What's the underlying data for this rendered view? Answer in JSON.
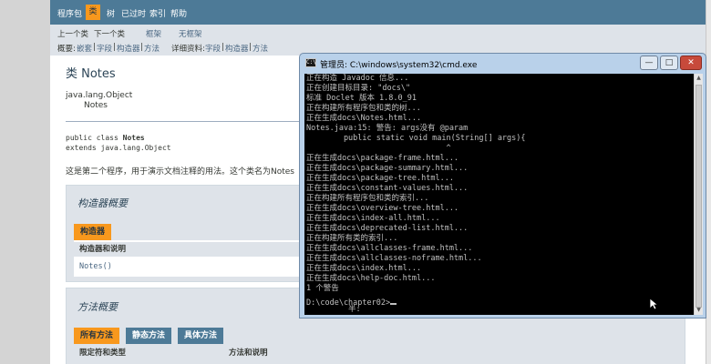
{
  "topnav": {
    "items": [
      "程序包",
      "类",
      "树",
      "已过时",
      "索引",
      "帮助"
    ],
    "active": "类"
  },
  "subnav": {
    "prev_class": "上一个类",
    "next_class": "下一个类",
    "frames": "框架",
    "no_frames": "无框架",
    "summary_label": "概要:",
    "summary_nested": "嵌套",
    "summary_field": "字段",
    "summary_constr": "构造器",
    "summary_method": "方法",
    "detail_label": "详细资料:",
    "detail_field": "字段",
    "detail_constr": "构造器",
    "detail_method": "方法",
    "sep": "|"
  },
  "class_page": {
    "title": "类 Notes",
    "inherit_parent": "java.lang.Object",
    "inherit_child": "Notes",
    "sig_prefix": "public class ",
    "sig_name": "Notes",
    "sig_extends": "extends java.lang.Object",
    "description": "这是第二个程序，用于演示文档注释的用法。这个类名为Notes"
  },
  "constructor_summary": {
    "title": "构造器概要",
    "tab": "构造器",
    "col_head": "构造器和说明",
    "constructor": "Notes()"
  },
  "method_summary": {
    "title": "方法概要",
    "tabs": [
      "所有方法",
      "静态方法",
      "具体方法"
    ],
    "col_modifier": "限定符和类型",
    "col_method": "方法和说明"
  },
  "cmd": {
    "icon": "C:\\",
    "title": "管理员: C:\\windows\\system32\\cmd.exe",
    "btn_min": "—",
    "btn_max": "□",
    "btn_close": "✕",
    "lines": [
      "正在构造 Javadoc 信息...",
      "正在创建目标目录: \"docs\\\"",
      "标准 Doclet 版本 1.8.0_91",
      "正在构建所有程序包和类的树...",
      "正在生成docs\\Notes.html...",
      "Notes.java:15: 警告: args没有 @param",
      "        public static void main(String[] args){",
      "                              ^",
      "正在生成docs\\package-frame.html...",
      "正在生成docs\\package-summary.html...",
      "正在生成docs\\package-tree.html...",
      "正在生成docs\\constant-values.html...",
      "正在构建所有程序包和类的索引...",
      "正在生成docs\\overview-tree.html...",
      "正在生成docs\\index-all.html...",
      "正在生成docs\\deprecated-list.html...",
      "正在构建所有类的索引...",
      "正在生成docs\\allclasses-frame.html...",
      "正在生成docs\\allclasses-noframe.html...",
      "正在生成docs\\index.html...",
      "正在生成docs\\help-doc.html...",
      "1 个警告",
      "",
      "D:\\code\\chapter02>"
    ],
    "ime": "半:"
  }
}
